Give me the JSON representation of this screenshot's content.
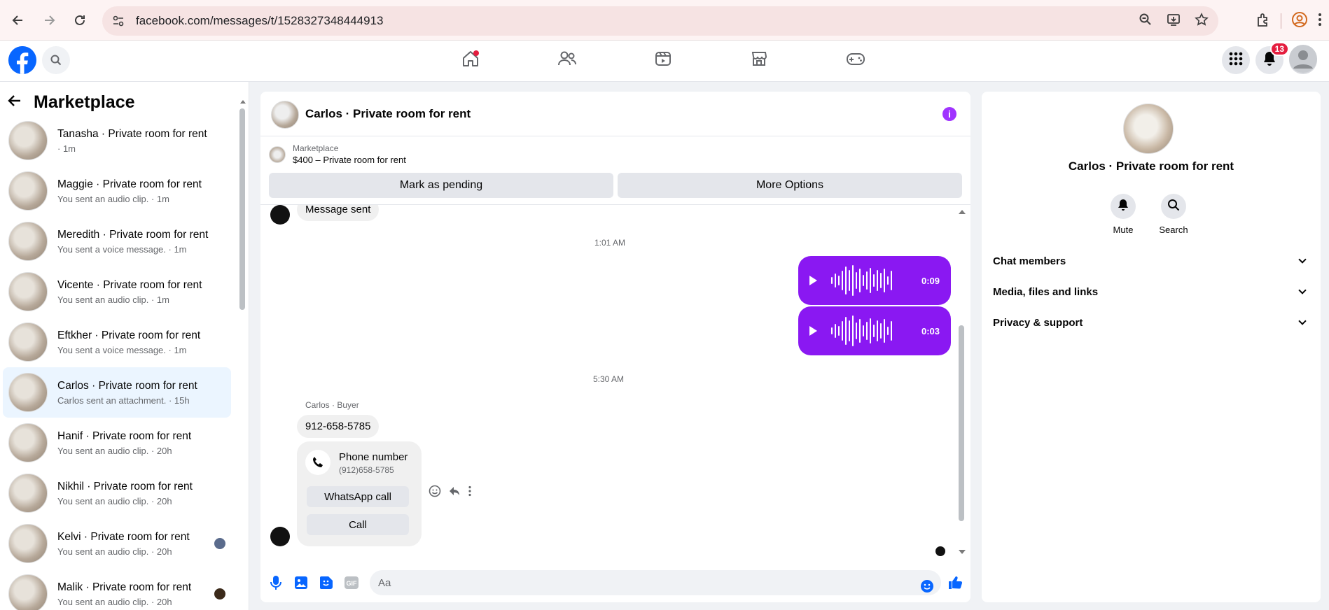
{
  "browser": {
    "url": "facebook.com/messages/t/1528327348444913"
  },
  "header": {
    "notification_count": "13"
  },
  "sidebar": {
    "title": "Marketplace",
    "conversations": [
      {
        "name": "Tanasha · Private room for rent",
        "preview": " · 1m"
      },
      {
        "name": "Maggie · Private room for rent",
        "preview": "You sent an audio clip. · 1m"
      },
      {
        "name": "Meredith · Private room for rent",
        "preview": "You sent a voice message. · 1m"
      },
      {
        "name": "Vicente · Private room for rent",
        "preview": "You sent an audio clip. · 1m"
      },
      {
        "name": "Eftkher · Private room for rent",
        "preview": "You sent a voice message. · 1m"
      },
      {
        "name": "Carlos · Private room for rent",
        "preview": "Carlos sent an attachment. · 15h"
      },
      {
        "name": "Hanif · Private room for rent",
        "preview": "You sent an audio clip. · 20h"
      },
      {
        "name": "Nikhil · Private room for rent",
        "preview": "You sent an audio clip. · 20h"
      },
      {
        "name": "Kelvi · Private room for rent",
        "preview": "You sent an audio clip. · 20h"
      },
      {
        "name": "Malik · Private room for rent",
        "preview": "You sent an audio clip. · 20h"
      }
    ]
  },
  "chat": {
    "title": "Carlos · Private room for rent",
    "marketplace_label": "Marketplace",
    "listing": "$400 – Private room for rent",
    "mark_pending_label": "Mark as pending",
    "more_options_label": "More Options",
    "cut_message": "Message sent",
    "time_1": "1:01 AM",
    "audio_1_duration": "0:09",
    "audio_2_duration": "0:03",
    "time_2": "5:30 AM",
    "sender_label": "Carlos · Buyer",
    "phone_message": "912-658-5785",
    "card_title": "Phone number",
    "card_number": "(912)658-5785",
    "whatsapp_label": "WhatsApp call",
    "call_label": "Call",
    "composer_placeholder": "Aa"
  },
  "details": {
    "name": "Carlos · Private room for rent",
    "mute_label": "Mute",
    "search_label": "Search",
    "sections": [
      "Chat members",
      "Media, files and links",
      "Privacy & support"
    ]
  },
  "colors": {
    "accent": "#8a18f2",
    "fb_blue": "#0866ff",
    "badge_red": "#e41e3f"
  }
}
